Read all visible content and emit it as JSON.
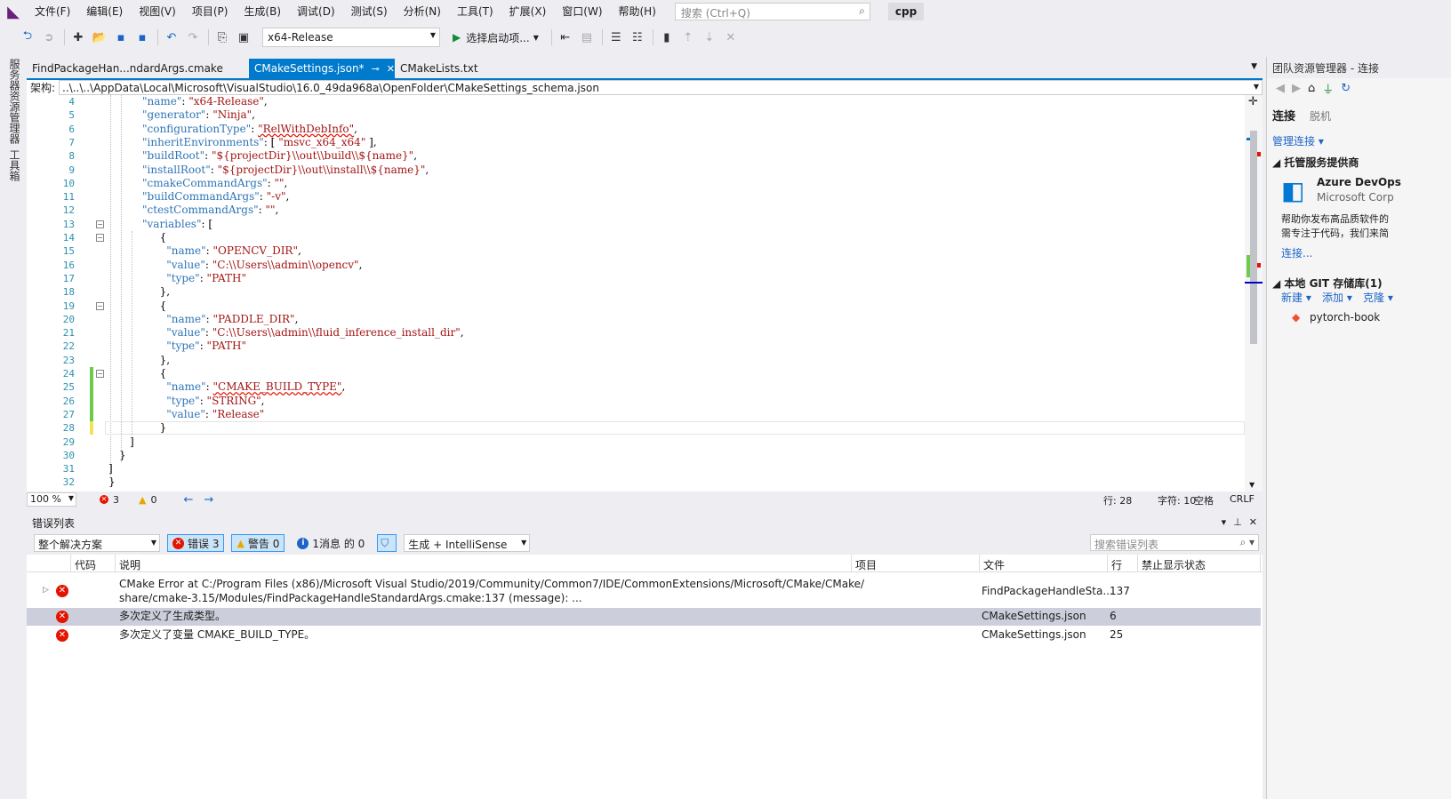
{
  "menu": {
    "items": [
      "文件(F)",
      "编辑(E)",
      "视图(V)",
      "项目(P)",
      "生成(B)",
      "调试(D)",
      "测试(S)",
      "分析(N)",
      "工具(T)",
      "扩展(X)",
      "窗口(W)",
      "帮助(H)"
    ],
    "search_placeholder": "搜索 (Ctrl+Q)",
    "solution_name": "cpp"
  },
  "toolbar": {
    "config": "x64-Release",
    "start_label": "选择启动项..."
  },
  "left_strip": {
    "tab1": "服务器资源管理器",
    "tab2": "工具箱"
  },
  "doc_tabs": [
    {
      "label": "FindPackageHan...ndardArgs.cmake",
      "active": false
    },
    {
      "label": "CMakeSettings.json*",
      "active": true
    },
    {
      "label": "CMakeLists.txt",
      "active": false
    }
  ],
  "navbar": {
    "label": "架构:",
    "path": "..\\..\\..\\AppData\\Local\\Microsoft\\VisualStudio\\16.0_49da968a\\OpenFolder\\CMakeSettings_schema.json"
  },
  "editor": {
    "line_numbers": [
      "4",
      "5",
      "6",
      "7",
      "8",
      "9",
      "10",
      "11",
      "12",
      "13",
      "14",
      "15",
      "16",
      "17",
      "18",
      "19",
      "20",
      "21",
      "22",
      "23",
      "24",
      "25",
      "26",
      "27",
      "28",
      "29",
      "30",
      "31",
      "32"
    ],
    "lines": [
      [
        [
          "k",
          "\"name\""
        ],
        [
          "p",
          ": "
        ],
        [
          "s",
          "\"x64-Release\""
        ],
        [
          "p",
          ","
        ]
      ],
      [
        [
          "k",
          "\"generator\""
        ],
        [
          "p",
          ": "
        ],
        [
          "s",
          "\"Ninja\""
        ],
        [
          "p",
          ","
        ]
      ],
      [
        [
          "k",
          "\"configurationType\""
        ],
        [
          "p",
          ": "
        ],
        [
          "sq",
          "\"RelWithDebInfo\""
        ],
        [
          "p",
          ","
        ]
      ],
      [
        [
          "k",
          "\"inheritEnvironments\""
        ],
        [
          "p",
          ": [ "
        ],
        [
          "s",
          "\"msvc_x64_x64\""
        ],
        [
          "p",
          " ],"
        ]
      ],
      [
        [
          "k",
          "\"buildRoot\""
        ],
        [
          "p",
          ": "
        ],
        [
          "s",
          "\"${projectDir}\\\\out\\\\build\\\\${name}\""
        ],
        [
          "p",
          ","
        ]
      ],
      [
        [
          "k",
          "\"installRoot\""
        ],
        [
          "p",
          ": "
        ],
        [
          "s",
          "\"${projectDir}\\\\out\\\\install\\\\${name}\""
        ],
        [
          "p",
          ","
        ]
      ],
      [
        [
          "k",
          "\"cmakeCommandArgs\""
        ],
        [
          "p",
          ": "
        ],
        [
          "s",
          "\"\""
        ],
        [
          "p",
          ","
        ]
      ],
      [
        [
          "k",
          "\"buildCommandArgs\""
        ],
        [
          "p",
          ": "
        ],
        [
          "s",
          "\"-v\""
        ],
        [
          "p",
          ","
        ]
      ],
      [
        [
          "k",
          "\"ctestCommandArgs\""
        ],
        [
          "p",
          ": "
        ],
        [
          "s",
          "\"\""
        ],
        [
          "p",
          ","
        ]
      ],
      [
        [
          "k",
          "\"variables\""
        ],
        [
          "p",
          ": ["
        ]
      ],
      [
        [
          "p",
          "  {"
        ]
      ],
      [
        [
          "k",
          "    \"name\""
        ],
        [
          "p",
          ": "
        ],
        [
          "s",
          "\"OPENCV_DIR\""
        ],
        [
          "p",
          ","
        ]
      ],
      [
        [
          "k",
          "    \"value\""
        ],
        [
          "p",
          ": "
        ],
        [
          "s",
          "\"C:\\\\Users\\\\admin\\\\opencv\""
        ],
        [
          "p",
          ","
        ]
      ],
      [
        [
          "k",
          "    \"type\""
        ],
        [
          "p",
          ": "
        ],
        [
          "s",
          "\"PATH\""
        ]
      ],
      [
        [
          "p",
          "  },"
        ]
      ],
      [
        [
          "p",
          "  {"
        ]
      ],
      [
        [
          "k",
          "    \"name\""
        ],
        [
          "p",
          ": "
        ],
        [
          "s",
          "\"PADDLE_DIR\""
        ],
        [
          "p",
          ","
        ]
      ],
      [
        [
          "k",
          "    \"value\""
        ],
        [
          "p",
          ": "
        ],
        [
          "s",
          "\"C:\\\\Users\\\\admin\\\\fluid_inference_install_dir\""
        ],
        [
          "p",
          ","
        ]
      ],
      [
        [
          "k",
          "    \"type\""
        ],
        [
          "p",
          ": "
        ],
        [
          "s",
          "\"PATH\""
        ]
      ],
      [
        [
          "p",
          "  },"
        ]
      ],
      [
        [
          "p",
          "  {"
        ]
      ],
      [
        [
          "k",
          "    \"name\""
        ],
        [
          "p",
          ": "
        ],
        [
          "sq",
          "\"CMAKE_BUILD_TYPE\""
        ],
        [
          "p",
          ","
        ]
      ],
      [
        [
          "k",
          "    \"type\""
        ],
        [
          "p",
          ": "
        ],
        [
          "s",
          "\"STRING\""
        ],
        [
          "p",
          ","
        ]
      ],
      [
        [
          "k",
          "    \"value\""
        ],
        [
          "p",
          ": "
        ],
        [
          "s",
          "\"Release\""
        ]
      ],
      [
        [
          "p",
          "  }"
        ]
      ],
      [
        [
          "p",
          "]"
        ]
      ],
      [
        [
          "p",
          "}"
        ]
      ],
      [
        [
          "p",
          "]"
        ]
      ],
      [
        [
          "p",
          "}"
        ]
      ]
    ]
  },
  "editor_status": {
    "zoom": "100 %",
    "errors": "3",
    "warnings": "0",
    "line": "行: 28",
    "char": "字符: 10",
    "space": "空格",
    "eol": "CRLF"
  },
  "error_list": {
    "title": "错误列表",
    "scope": "整个解决方案",
    "errors_btn": "错误 3",
    "warnings_btn": "警告 0",
    "messages_btn": "1消息 的 0",
    "source": "生成 + IntelliSense",
    "search_placeholder": "搜索错误列表",
    "columns": [
      "代码",
      "说明",
      "项目",
      "文件",
      "行",
      "禁止显示状态"
    ],
    "rows": [
      {
        "desc1": "CMake Error at C:/Program Files (x86)/Microsoft Visual Studio/2019/Community/Common7/IDE/CommonExtensions/Microsoft/CMake/CMake/",
        "desc2": "share/cmake-3.15/Modules/FindPackageHandleStandardArgs.cmake:137 (message): ...",
        "file": "FindPackageHandleSta...",
        "line": "137"
      },
      {
        "desc1": "多次定义了生成类型。",
        "desc2": "",
        "file": "CMakeSettings.json",
        "line": "6"
      },
      {
        "desc1": "多次定义了变量 CMAKE_BUILD_TYPE。",
        "desc2": "",
        "file": "CMakeSettings.json",
        "line": "25"
      }
    ]
  },
  "team_explorer": {
    "title": "团队资源管理器 - 连接",
    "tab_connect": "连接",
    "tab_offline": "脱机",
    "manage": "管理连接",
    "hosted_header": "托管服务提供商",
    "azure_name": "Azure DevOps",
    "azure_corp": "Microsoft Corp",
    "azure_desc1": "帮助你发布高品质软件的",
    "azure_desc2": "需专注于代码，我们来简",
    "connect_link": "连接...",
    "git_header": "本地 GIT 存储库(1)",
    "git_new": "新建",
    "git_add": "添加",
    "git_clone": "克隆",
    "repo": "pytorch-book"
  },
  "colors": {
    "accent": "#007acc",
    "error": "#e51400",
    "keyword": "#2e75b6",
    "string": "#a31515",
    "line_number": "#2b91af"
  }
}
